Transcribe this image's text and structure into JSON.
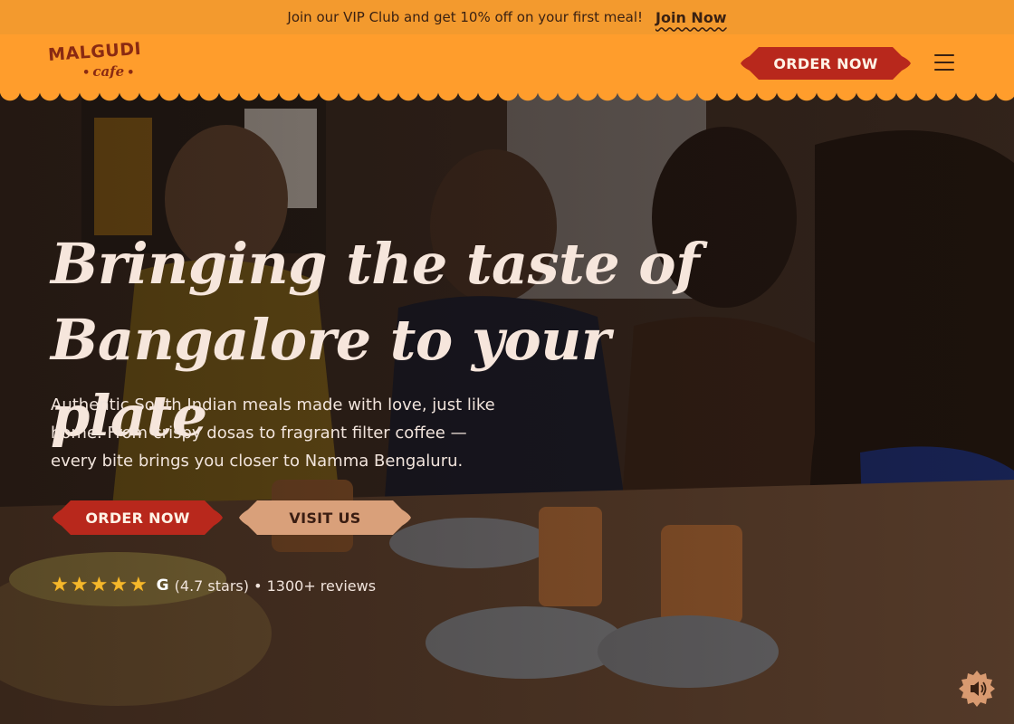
{
  "promo": {
    "text": "Join our VIP Club and get 10% off on your first meal!",
    "link_label": "Join Now"
  },
  "header": {
    "logo_main": "MALGUDI",
    "logo_sub": "cafe",
    "order_label": "ORDER NOW",
    "menu_icon": "hamburger-menu-icon"
  },
  "hero": {
    "title_line1": "Bringing the taste of",
    "title_line2": "Bangalore to your plate",
    "description": "Authentic South Indian meals made with love, just like home. From crispy dosas to fragrant filter coffee — every bite brings you closer to Namma Bengaluru.",
    "order_label": "ORDER NOW",
    "visit_label": "VISIT US",
    "rating_stars": 5,
    "rating_icon": "google-icon",
    "rating_text": "(4.7 stars) • 1300+ reviews"
  },
  "sound": {
    "icon": "speaker-volume-icon"
  },
  "colors": {
    "brand_orange": "#ff9d2c",
    "promo_orange": "#f39a2e",
    "button_red": "#b8281c",
    "button_tan": "#d9a07a",
    "dark_brown": "#3a2112",
    "logo_brown": "#8a2a12",
    "star_gold": "#f5b82b"
  }
}
